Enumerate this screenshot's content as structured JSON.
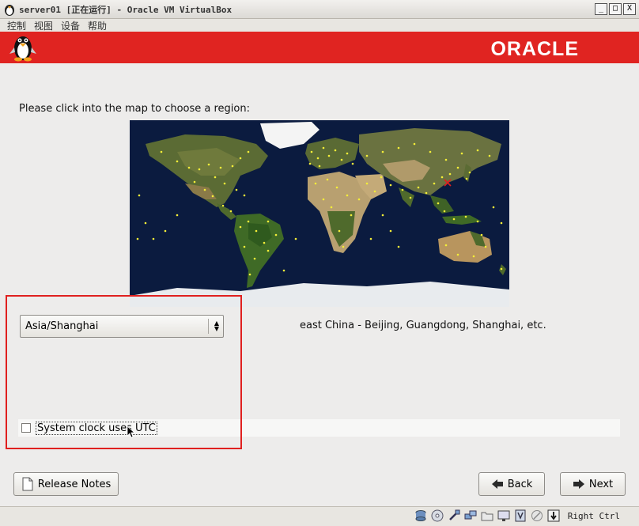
{
  "window": {
    "title": "server01 [正在运行] - Oracle VM VirtualBox",
    "minimize": "_",
    "maximize": "□",
    "close": "X"
  },
  "menu": [
    "控制",
    "视图",
    "设备",
    "帮助"
  ],
  "banner": {
    "logo_text": "ORACLE",
    "brand_color": "#e02421"
  },
  "installer": {
    "map_prompt": "Please click into the map to choose a region:",
    "timezone_value": "Asia/Shanghai",
    "timezone_description": "east China - Beijing, Guangdong, Shanghai, etc.",
    "utc_label": "System clock uses UTC",
    "utc_checked": false
  },
  "buttons": {
    "release_notes": "Release Notes",
    "back": "Back",
    "next": "Next"
  },
  "status": {
    "host_key": "Right Ctrl"
  },
  "icons": [
    "hard-disk-icon",
    "cd-icon",
    "usb-icon",
    "network-icon",
    "shared-folder-icon",
    "display-icon",
    "video-capture-icon",
    "mouse-integration-icon",
    "keyboard-icon"
  ]
}
